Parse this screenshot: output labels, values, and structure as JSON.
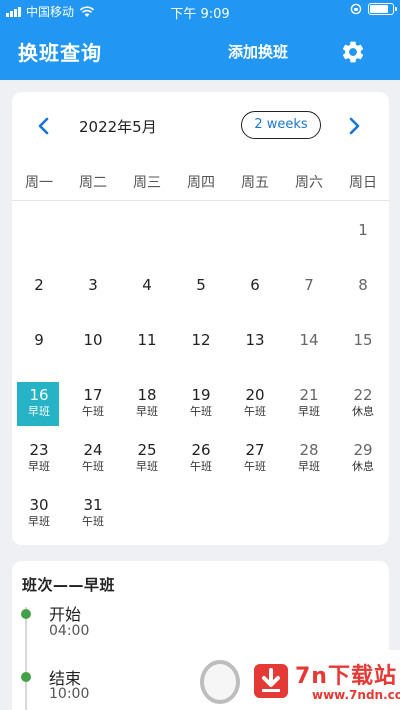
{
  "status_bar": {
    "carrier": "中国移动",
    "time": "下午 9:09",
    "battery_level": 0.85
  },
  "app_bar": {
    "title": "换班查询",
    "add_shift_label": "添加换班",
    "settings_icon": "gear-icon"
  },
  "calendar": {
    "month_title": "2022年5月",
    "format_button": "2 weeks",
    "weekdays": [
      "周一",
      "周二",
      "周三",
      "周四",
      "周五",
      "周六",
      "周日"
    ],
    "today": 16,
    "days": [
      {
        "day": "",
        "shift": ""
      },
      {
        "day": "",
        "shift": ""
      },
      {
        "day": "",
        "shift": ""
      },
      {
        "day": "",
        "shift": ""
      },
      {
        "day": "",
        "shift": ""
      },
      {
        "day": "",
        "shift": ""
      },
      {
        "day": "1",
        "shift": ""
      },
      {
        "day": "2",
        "shift": ""
      },
      {
        "day": "3",
        "shift": ""
      },
      {
        "day": "4",
        "shift": ""
      },
      {
        "day": "5",
        "shift": ""
      },
      {
        "day": "6",
        "shift": ""
      },
      {
        "day": "7",
        "shift": ""
      },
      {
        "day": "8",
        "shift": ""
      },
      {
        "day": "9",
        "shift": ""
      },
      {
        "day": "10",
        "shift": ""
      },
      {
        "day": "11",
        "shift": ""
      },
      {
        "day": "12",
        "shift": ""
      },
      {
        "day": "13",
        "shift": ""
      },
      {
        "day": "14",
        "shift": ""
      },
      {
        "day": "15",
        "shift": ""
      },
      {
        "day": "16",
        "shift": "早班"
      },
      {
        "day": "17",
        "shift": "午班"
      },
      {
        "day": "18",
        "shift": "早班"
      },
      {
        "day": "19",
        "shift": "午班"
      },
      {
        "day": "20",
        "shift": "午班"
      },
      {
        "day": "21",
        "shift": "早班"
      },
      {
        "day": "22",
        "shift": "休息"
      },
      {
        "day": "23",
        "shift": "早班"
      },
      {
        "day": "24",
        "shift": "午班"
      },
      {
        "day": "25",
        "shift": "早班"
      },
      {
        "day": "26",
        "shift": "午班"
      },
      {
        "day": "27",
        "shift": "午班"
      },
      {
        "day": "28",
        "shift": "早班"
      },
      {
        "day": "29",
        "shift": "休息"
      },
      {
        "day": "30",
        "shift": "早班"
      },
      {
        "day": "31",
        "shift": "午班"
      }
    ]
  },
  "shift_detail": {
    "title": "班次——早班",
    "start_label": "开始",
    "start_time": "04:00",
    "end_label": "结束",
    "end_time": "10:00"
  },
  "watermark": {
    "brand": "7n下载站",
    "url": "www.7ndn.com"
  },
  "colors": {
    "primary": "#2196f3",
    "today": "#26b3c5",
    "timeline_dot": "#43a047",
    "watermark": "#e53935"
  }
}
